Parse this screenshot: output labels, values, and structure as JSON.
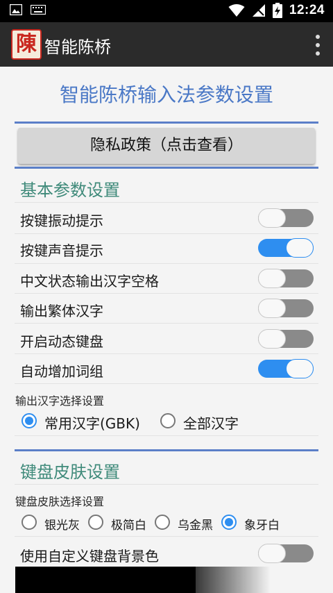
{
  "status_bar": {
    "time": "12:24",
    "icons": [
      "image-icon",
      "keyboard-icon",
      "wifi-icon",
      "signal-icon",
      "battery-charging-icon"
    ]
  },
  "app_bar": {
    "logo_text": "陳",
    "title": "智能陈桥",
    "menu_icon": "more-vert-icon"
  },
  "page": {
    "heading": "智能陈桥输入法参数设置",
    "privacy_button": "隐私政策（点击查看）"
  },
  "basic_settings": {
    "title": "基本参数设置",
    "items": [
      {
        "label": "按键振动提示",
        "on": false
      },
      {
        "label": "按键声音提示",
        "on": true
      },
      {
        "label": "中文状态输出汉字空格",
        "on": false
      },
      {
        "label": "输出繁体汉字",
        "on": false
      },
      {
        "label": "开启动态键盘",
        "on": false
      },
      {
        "label": "自动增加词组",
        "on": true
      }
    ]
  },
  "output_selection": {
    "title": "输出汉字选择设置",
    "options": [
      {
        "label": "常用汉字(GBK)",
        "checked": true
      },
      {
        "label": "全部汉字",
        "checked": false
      }
    ]
  },
  "skin_settings": {
    "title": "键盘皮肤设置",
    "subtitle": "键盘皮肤选择设置",
    "options": [
      {
        "label": "银光灰",
        "checked": false
      },
      {
        "label": "极简白",
        "checked": false
      },
      {
        "label": "乌金黑",
        "checked": false
      },
      {
        "label": "象牙白",
        "checked": true
      }
    ],
    "custom_bg": {
      "label": "使用自定义键盘背景色",
      "on": false
    }
  },
  "colors": {
    "accent": "#2e8ef0",
    "heading_blue": "#4a78c6",
    "section_teal": "#3f8a7a",
    "app_bar": "#2b2b2b"
  }
}
